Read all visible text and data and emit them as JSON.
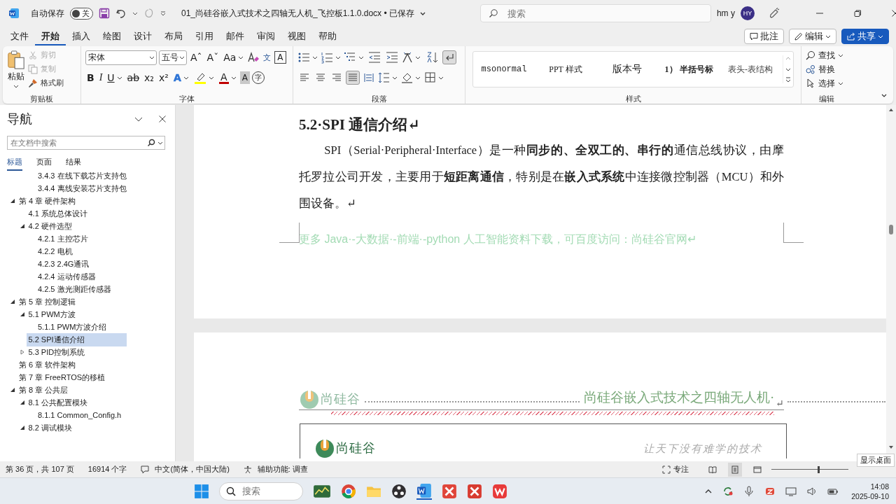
{
  "title_bar": {
    "autosave_label": "自动保存",
    "autosave": {
      "label": "关",
      "on": false
    },
    "document_title": "01_尚硅谷嵌入式技术之四轴无人机_飞控板1.1.0.docx • 已保存",
    "search": {
      "placeholder": "搜索"
    },
    "user_name": "hm y",
    "avatar": "HY"
  },
  "menu_tabs": [
    {
      "label": "文件",
      "selected": false
    },
    {
      "label": "开始",
      "selected": true
    },
    {
      "label": "插入",
      "selected": false
    },
    {
      "label": "绘图",
      "selected": false
    },
    {
      "label": "设计",
      "selected": false
    },
    {
      "label": "布局",
      "selected": false
    },
    {
      "label": "引用",
      "selected": false
    },
    {
      "label": "邮件",
      "selected": false
    },
    {
      "label": "审阅",
      "selected": false
    },
    {
      "label": "视图",
      "selected": false
    },
    {
      "label": "帮助",
      "selected": false
    }
  ],
  "action_buttons": [
    {
      "kind": "comment",
      "label": "批注"
    },
    {
      "kind": "edit",
      "label": "编辑"
    },
    {
      "kind": "share",
      "label": "共享"
    }
  ],
  "ribbon": {
    "clipboard": {
      "paste": "粘贴",
      "items": [
        {
          "kind": "cut",
          "label": "剪切",
          "disabled": true
        },
        {
          "kind": "copy",
          "label": "复制",
          "disabled": true
        },
        {
          "kind": "painter",
          "label": "格式刷",
          "disabled": false
        }
      ],
      "group_label": "剪贴板"
    },
    "font": {
      "name": "宋体",
      "size": "五号",
      "row1": [
        {
          "kind": "glyph",
          "text": "Aˆ"
        },
        {
          "kind": "glyph",
          "text": "Aˇ"
        },
        {
          "kind": "dropdown",
          "text": "Aa"
        },
        {
          "kind": "clear"
        },
        {
          "kind": "phonetic",
          "text": "文"
        },
        {
          "kind": "boxed",
          "text": "A"
        }
      ],
      "row2": [
        {
          "kind": "bold",
          "text": "B"
        },
        {
          "kind": "italic",
          "text": "I"
        },
        {
          "kind": "underline",
          "text": "U"
        },
        {
          "kind": "strike",
          "text": "ab"
        },
        {
          "kind": "glyph",
          "text": "x₂"
        },
        {
          "kind": "glyph",
          "text": "x²"
        },
        {
          "kind": "effects",
          "text": "A"
        },
        {
          "kind": "highlight",
          "color": "#ffff00"
        },
        {
          "kind": "fontcolor",
          "text": "A",
          "color": "#c00000"
        },
        {
          "kind": "shaded",
          "text": "A"
        },
        {
          "kind": "circled",
          "text": "字"
        }
      ],
      "group_label": "字体"
    },
    "paragraph": {
      "alignments": [
        {
          "selected": false
        },
        {
          "selected": false
        },
        {
          "selected": false
        },
        {
          "selected": true
        },
        {
          "selected": false
        }
      ],
      "show_marks": {
        "on": true
      },
      "group_label": "段落"
    },
    "styles": {
      "items": [
        {
          "kind": "mono",
          "label": "msonormal"
        },
        {
          "kind": "serif",
          "label": "PPT 样式"
        },
        {
          "kind": "large",
          "label": "版本号"
        },
        {
          "kind": "bold",
          "label": "1） 半括号标"
        },
        {
          "kind": "plain",
          "label": "表头-表结构"
        }
      ],
      "group_label": "样式"
    },
    "editing": {
      "items": [
        {
          "kind": "find",
          "label": "查找"
        },
        {
          "kind": "replace",
          "label": "替换"
        },
        {
          "kind": "select",
          "label": "选择"
        }
      ],
      "group_label": "编辑"
    }
  },
  "nav": {
    "title": "导航",
    "search": {
      "placeholder": "在文档中搜索"
    },
    "tabs": [
      {
        "label": "标题",
        "selected": true
      },
      {
        "label": "页面",
        "selected": false
      },
      {
        "label": "结果",
        "selected": false
      }
    ],
    "tree": [
      {
        "children": [
          {
            "children": [
              {
                "label": "3.4.3 在线下载芯片支持包",
                "selected": false
              },
              {
                "label": "3.4.4 离线安装芯片支持包",
                "selected": false
              }
            ]
          }
        ]
      },
      {
        "label": "第 4 章 硬件架构",
        "selected": false,
        "expanded": true,
        "children": [
          {
            "label": "4.1 系统总体设计",
            "selected": false
          },
          {
            "label": "4.2 硬件选型",
            "selected": false,
            "expanded": true,
            "children": [
              {
                "label": "4.2.1 主控芯片",
                "selected": false
              },
              {
                "label": "4.2.2 电机",
                "selected": false
              },
              {
                "label": "4.2.3 2.4G通讯",
                "selected": false
              },
              {
                "label": "4.2.4 运动传感器",
                "selected": false
              },
              {
                "label": "4.2.5 激光测距传感器",
                "selected": false
              }
            ]
          }
        ]
      },
      {
        "label": "第 5 章 控制逻辑",
        "selected": false,
        "expanded": true,
        "children": [
          {
            "label": "5.1 PWM方波",
            "selected": false,
            "expanded": true,
            "children": [
              {
                "label": "5.1.1 PWM方波介绍",
                "selected": false
              }
            ]
          },
          {
            "label": "5.2 SPI通信介绍",
            "selected": true
          },
          {
            "label": "5.3 PID控制系统",
            "selected": false,
            "expanded": false
          }
        ]
      },
      {
        "label": "第 6 章 软件架构",
        "selected": false
      },
      {
        "label": "第 7 章 FreeRTOS的移植",
        "selected": false
      },
      {
        "label": "第 8 章 公共层",
        "selected": false,
        "expanded": true,
        "children": [
          {
            "label": "8.1 公共配置模块",
            "selected": false,
            "expanded": true,
            "children": [
              {
                "label": "8.1.1 Common_Config.h",
                "selected": false
              }
            ]
          },
          {
            "label": "8.2 调试模块",
            "selected": false,
            "expanded": true
          }
        ]
      }
    ]
  },
  "document": {
    "heading": "5.2·SPI 通信介绍↵",
    "paragraph": "SPI（Serial·Peripheral·Interface）是一种**同步的、全双工的、串行的**通信总线协议，由摩托罗拉公司开发，主要用于**短距离通信**，特别是在**嵌入式系统**中连接微控制器（MCU）和外围设备。↵",
    "footer": "更多 Java·-大数据·-前端·-python 人工智能资料下载，可百度访问：尚硅谷官网↵",
    "header_logo": "尚硅谷",
    "header_title": "尚硅谷嵌入式技术之四轴无人机·",
    "header_mark": "↵",
    "banner_logo": "尚硅谷",
    "banner_slogan": "让天下没有难学的技术"
  },
  "status_bar": {
    "page": "第 36 页，共 107 页",
    "words": "16914 个字",
    "language": "中文(简体，中国大陆)",
    "accessibility": "辅助功能: 调查",
    "focus": "专注",
    "zoom": {
      "level": 0.6
    }
  },
  "tooltip": "显示桌面",
  "taskbar": {
    "search": {
      "placeholder": "搜索"
    },
    "time": "14:08",
    "date": "2025-09-10"
  }
}
